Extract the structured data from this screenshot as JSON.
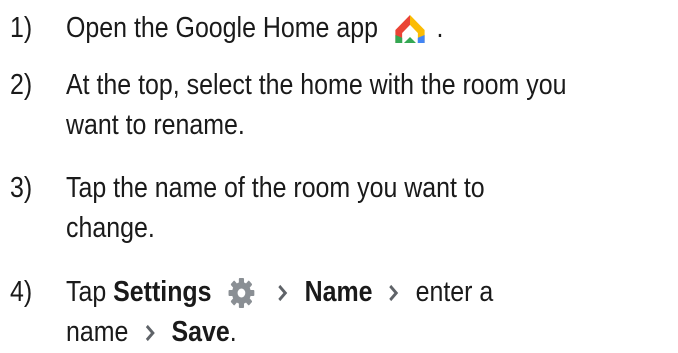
{
  "steps": [
    {
      "number": "1)",
      "pre": "Open the Google Home app",
      "post": ".",
      "icon": "google-home-app-icon"
    },
    {
      "number": "2)",
      "line1": "At the top, select the home with the room you",
      "line2": "want to rename."
    },
    {
      "number": "3)",
      "line1": "Tap the name of the room you want to",
      "line2": "change."
    },
    {
      "number": "4)",
      "tap": "Tap",
      "settings": "Settings",
      "settings_icon": "gear-icon",
      "name_label": "Name",
      "enter": "enter a",
      "name_word": "name",
      "save": "Save",
      "period": ".",
      "separator_icon": "chevron-right-icon"
    }
  ],
  "colors": {
    "text": "#1a1a1a",
    "chevron": "#5f6368",
    "gear": "#8a8f94",
    "home_red": "#ea4335",
    "home_yellow": "#fbbc04",
    "home_green": "#34a853",
    "home_blue": "#4285f4"
  }
}
